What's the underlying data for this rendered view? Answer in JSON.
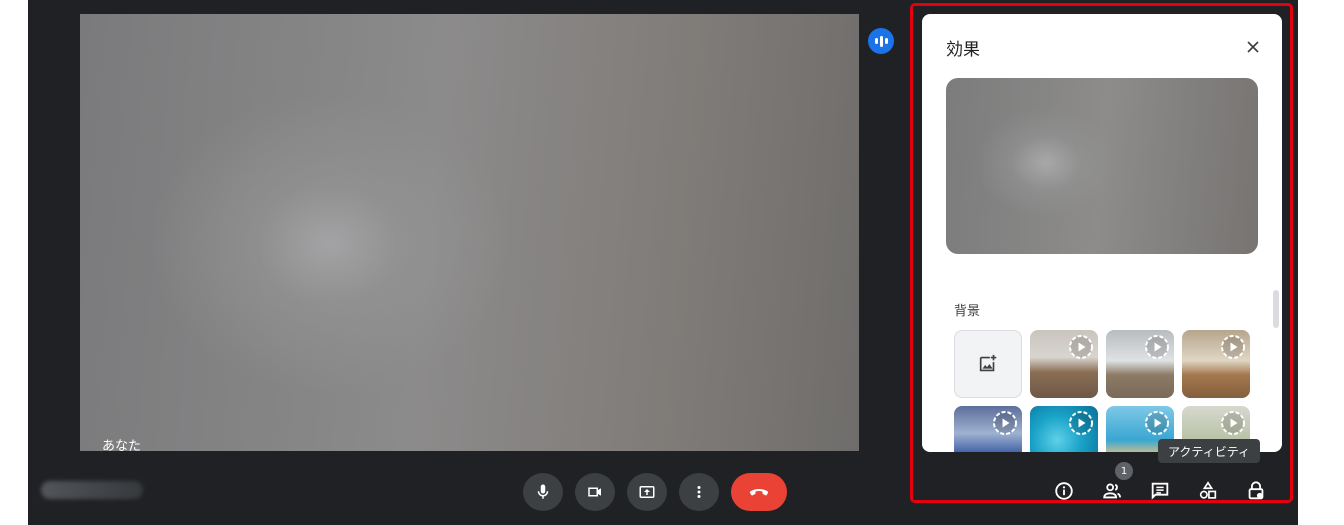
{
  "stage": {
    "self_name": "あなた"
  },
  "effects_panel": {
    "title": "効果",
    "background_section_label": "背景"
  },
  "bottom_bar": {
    "participants_badge": "1",
    "tooltip": "アクティビティ"
  },
  "colors": {
    "app_background": "#202124",
    "control_button": "#3c4043",
    "end_call": "#ea4335",
    "speaking_indicator": "#1a73e8",
    "highlight_border": "#e3000f"
  },
  "icons": [
    "mic-icon",
    "camera-icon",
    "present-icon",
    "more-options-icon",
    "end-call-icon",
    "close-icon",
    "add-image-icon",
    "animated-play-icon",
    "info-icon",
    "people-icon",
    "chat-icon",
    "activities-icon",
    "host-controls-icon"
  ]
}
